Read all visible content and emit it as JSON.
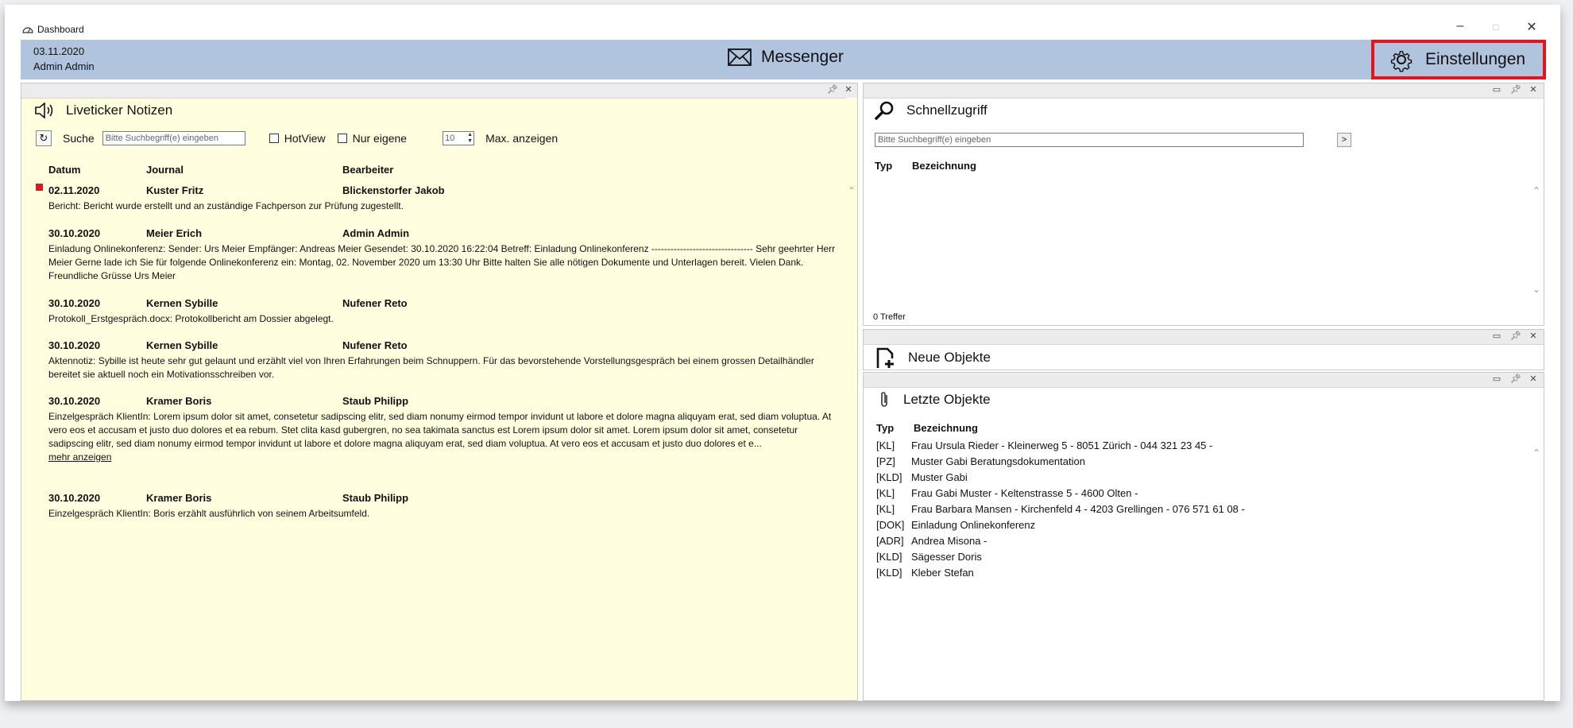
{
  "window": {
    "title": "Dashboard",
    "controls": {
      "minimize": "–",
      "maximize": "□",
      "close": "✕"
    }
  },
  "header": {
    "date": "03.11.2020",
    "user": "Admin Admin",
    "messenger_label": "Messenger",
    "settings_label": "Einstellungen",
    "highlight_color": "#e3141b",
    "band_color": "#b0c4de"
  },
  "liveticker": {
    "title": "Liveticker Notizen",
    "search_label": "Suche",
    "search_placeholder": "Bitte Suchbegriff(e) eingeben",
    "hotview_label": "HotView",
    "nur_eigene_label": "Nur eigene",
    "max_value": "10",
    "max_label": "Max. anzeigen",
    "columns": [
      "Datum",
      "Journal",
      "Bearbeiter"
    ],
    "entries": [
      {
        "date": "02.11.2020",
        "journal": "Kuster Fritz",
        "bearbeiter": "Blickenstorfer Jakob",
        "text": "Bericht: Bericht wurde erstellt und an zuständige Fachperson zur Prüfung zugestellt.",
        "flag": true
      },
      {
        "date": "30.10.2020",
        "journal": "Meier Erich",
        "bearbeiter": "Admin Admin",
        "text": "Einladung Onlinekonferenz: Sender: Urs Meier Empfänger: Andreas Meier Gesendet: 30.10.2020 16:22:04 Betreff: Einladung Onlinekonferenz -------------------------------- Sehr geehrter Herr Meier Gerne lade ich Sie für folgende Onlinekonferenz ein: Montag, 02. November 2020 um 13:30 Uhr Bitte halten Sie alle nötigen Dokumente und Unterlagen bereit. Vielen Dank. Freundliche Grüsse Urs Meier"
      },
      {
        "date": "30.10.2020",
        "journal": "Kernen Sybille",
        "bearbeiter": "Nufener Reto",
        "text": "Protokoll_Erstgespräch.docx: Protokollbericht am Dossier abgelegt."
      },
      {
        "date": "30.10.2020",
        "journal": "Kernen Sybille",
        "bearbeiter": "Nufener Reto",
        "text": "Aktennotiz: Sybille ist heute sehr gut gelaunt und erzählt viel von Ihren Erfahrungen beim Schnuppern. Für das bevorstehende Vorstellungsgespräch bei einem grossen Detailhändler bereitet sie aktuell noch ein Motivationsschreiben vor."
      },
      {
        "date": "30.10.2020",
        "journal": "Kramer Boris",
        "bearbeiter": "Staub Philipp",
        "text": "Einzelgespräch KlientIn: Lorem ipsum dolor sit amet, consetetur sadipscing elitr, sed diam nonumy eirmod tempor invidunt ut labore et dolore magna aliquyam erat, sed diam voluptua. At vero eos et accusam et justo duo dolores et ea rebum. Stet clita kasd gubergren, no sea takimata sanctus est Lorem ipsum dolor sit amet. Lorem ipsum dolor sit amet, consetetur sadipscing elitr, sed diam nonumy eirmod tempor invidunt ut labore et dolore magna aliquyam erat, sed diam voluptua. At vero eos et accusam et justo duo dolores et e...",
        "more": "mehr anzeigen"
      },
      {
        "date": "30.10.2020",
        "journal": "Kramer Boris",
        "bearbeiter": "Staub Philipp",
        "text": "Einzelgespräch KlientIn: Boris erzählt ausführlich von seinem Arbeitsumfeld."
      }
    ]
  },
  "schnellzugriff": {
    "title": "Schnellzugriff",
    "search_placeholder": "Bitte Suchbegriff(e) eingeben",
    "go_label": ">",
    "columns": [
      "Typ",
      "Bezeichnung"
    ],
    "count_text": "0 Treffer"
  },
  "neue_objekte": {
    "title": "Neue Objekte"
  },
  "letzte_objekte": {
    "title": "Letzte Objekte",
    "columns": [
      "Typ",
      "Bezeichnung"
    ],
    "rows": [
      {
        "typ": "[KL]",
        "bez": "Frau Ursula Rieder - Kleinerweg 5 - 8051 Zürich - 044 321 23 45 -"
      },
      {
        "typ": "[PZ]",
        "bez": "Muster Gabi Beratungsdokumentation"
      },
      {
        "typ": "[KLD]",
        "bez": "Muster Gabi"
      },
      {
        "typ": "[KL]",
        "bez": "Frau Gabi Muster - Keltenstrasse 5 - 4600 Olten -"
      },
      {
        "typ": "[KL]",
        "bez": "Frau Barbara Mansen - Kirchenfeld 4 - 4203 Grellingen - 076 571 61 08 -"
      },
      {
        "typ": "[DOK]",
        "bez": "Einladung Onlinekonferenz"
      },
      {
        "typ": "[ADR]",
        "bez": "Andrea Misona -"
      },
      {
        "typ": "[KLD]",
        "bez": "Sägesser Doris"
      },
      {
        "typ": "[KLD]",
        "bez": "Kleber Stefan"
      }
    ]
  }
}
